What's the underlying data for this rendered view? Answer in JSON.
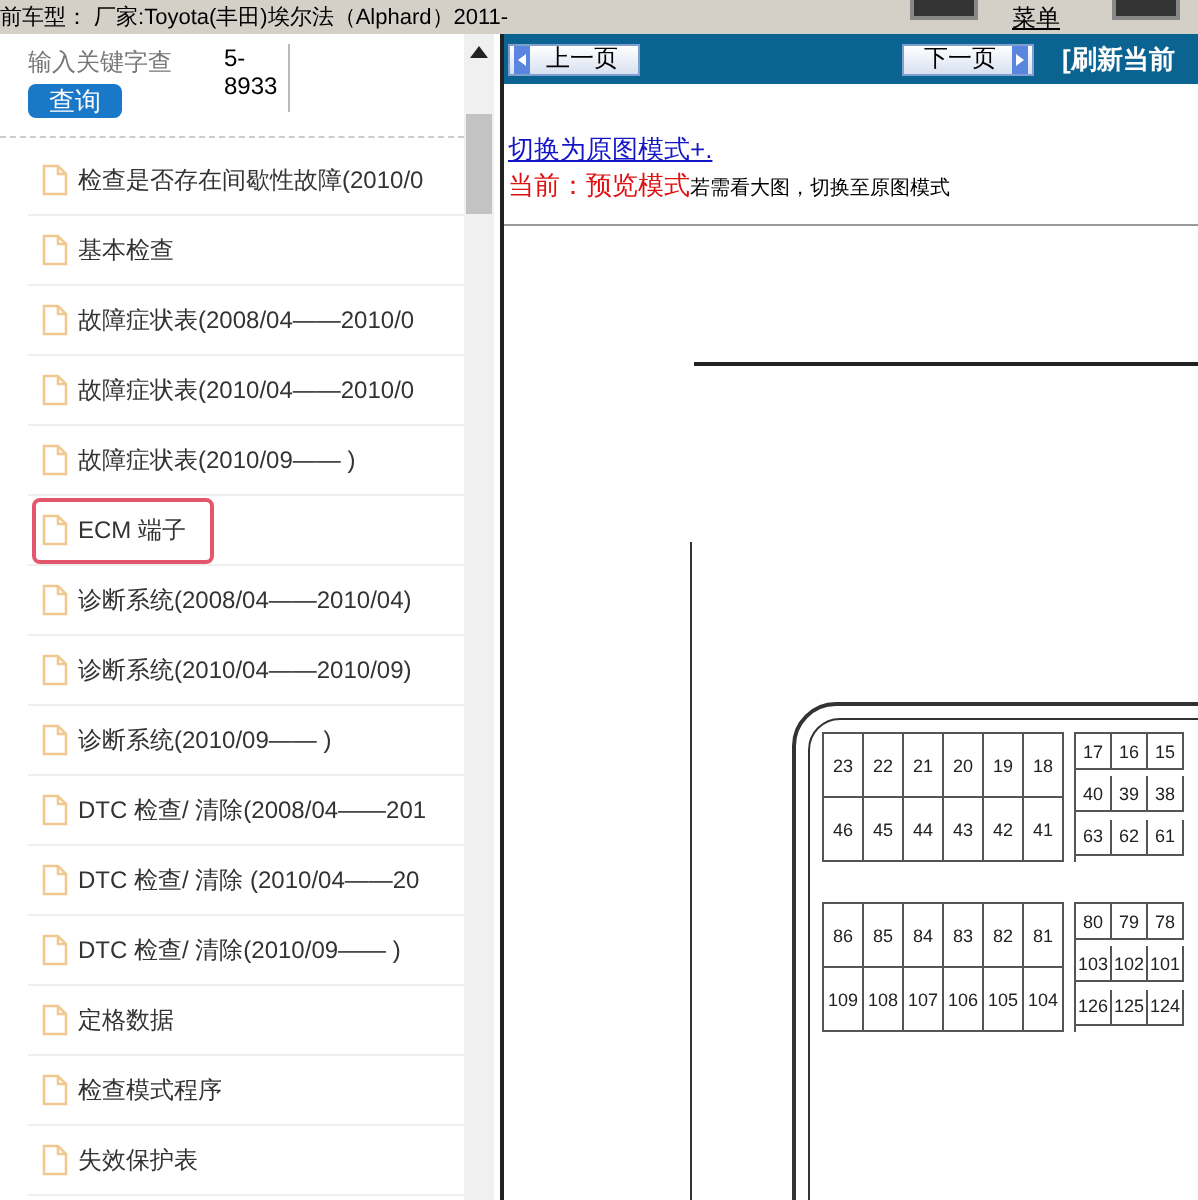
{
  "header": {
    "vehicle": "前车型： 厂家:Toyota(丰田)埃尔法（Alphard）2011-",
    "menu": "菜单"
  },
  "sidebar": {
    "search": {
      "placeholder": "输入关键字查"
    },
    "search_button": "查询",
    "code": "5-8933",
    "items": [
      {
        "label": "检查是否存在间歇性故障(2010/0",
        "selected": false
      },
      {
        "label": "基本检查",
        "selected": false
      },
      {
        "label": "故障症状表(2008/04——2010/0",
        "selected": false
      },
      {
        "label": "故障症状表(2010/04——2010/0",
        "selected": false
      },
      {
        "label": "故障症状表(2010/09—— )",
        "selected": false
      },
      {
        "label": "ECM 端子",
        "selected": true
      },
      {
        "label": "诊断系统(2008/04——2010/04)",
        "selected": false
      },
      {
        "label": "诊断系统(2010/04——2010/09)",
        "selected": false
      },
      {
        "label": "诊断系统(2010/09—— )",
        "selected": false
      },
      {
        "label": "DTC 检查/ 清除(2008/04——201",
        "selected": false
      },
      {
        "label": "DTC 检查/ 清除 (2010/04——20",
        "selected": false
      },
      {
        "label": "DTC 检查/ 清除(2010/09—— )",
        "selected": false
      },
      {
        "label": "定格数据",
        "selected": false
      },
      {
        "label": "检查模式程序",
        "selected": false
      },
      {
        "label": "失效保护表",
        "selected": false
      }
    ]
  },
  "viewer": {
    "prev_button": "上一页",
    "next_button": "下一页",
    "refresh": "[刷新当前",
    "mode_link": "切换为原图模式+.",
    "current_mode": "当前：预览模式",
    "hint": "若需看大图，切换至原图模式"
  },
  "diagram": {
    "blocks": [
      {
        "rows": [
          [
            "23",
            "22",
            "21",
            "20",
            "19",
            "18"
          ],
          [
            "46",
            "45",
            "44",
            "43",
            "42",
            "41"
          ]
        ]
      },
      {
        "rows": [
          [
            "17",
            "16",
            "15"
          ],
          [
            "40",
            "39",
            "38"
          ],
          [
            "63",
            "62",
            "61"
          ]
        ]
      },
      {
        "rows": [
          [
            "86",
            "85",
            "84",
            "83",
            "82",
            "81"
          ],
          [
            "109",
            "108",
            "107",
            "106",
            "105",
            "104"
          ]
        ]
      },
      {
        "rows": [
          [
            "80",
            "79",
            "78"
          ],
          [
            "103",
            "102",
            "101"
          ],
          [
            "126",
            "125",
            "124"
          ]
        ]
      }
    ]
  }
}
